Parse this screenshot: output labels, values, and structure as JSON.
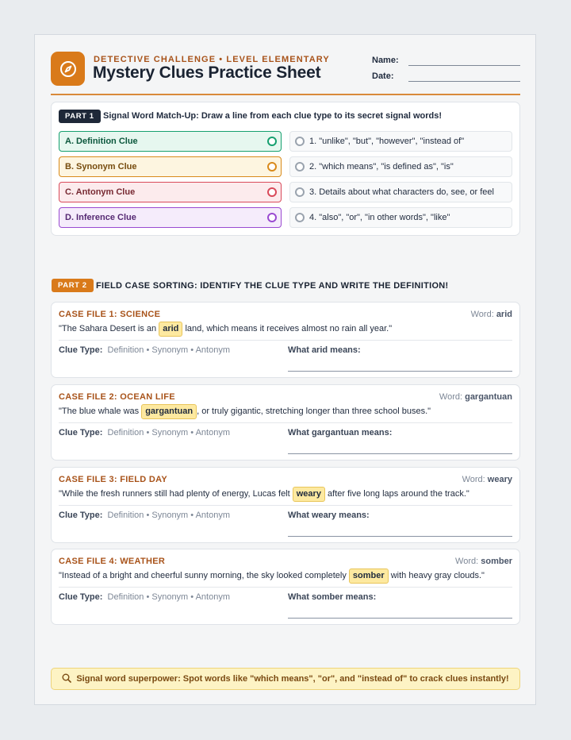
{
  "header": {
    "kicker": "DETECTIVE CHALLENGE • LEVEL ELEMENTARY",
    "title": "Mystery Clues Practice Sheet",
    "name_label": "Name:",
    "date_label": "Date:",
    "logo_icon": "compass-icon"
  },
  "part1": {
    "badge": "PART 1",
    "instruction": "Signal Word Match-Up: Draw a line from each clue type to its secret signal words!",
    "clues": [
      {
        "label": "A. Definition Clue",
        "color": "#16a06f",
        "bg": "#e6f7ef"
      },
      {
        "label": "B. Synonym Clue",
        "color": "#d98a1a",
        "bg": "#fdf5e0"
      },
      {
        "label": "C. Antonym Clue",
        "color": "#d94a5a",
        "bg": "#fcebed"
      },
      {
        "label": "D. Inference Clue",
        "color": "#9a4ad1",
        "bg": "#f5ecfb"
      }
    ],
    "signals": [
      "1. \"unlike\", \"but\", \"however\", \"instead of\"",
      "2. \"which means\", \"is defined as\", \"is\"",
      "3. Details about what characters do, see, or feel",
      "4. \"also\", \"or\", \"in other words\", \"like\""
    ]
  },
  "part2": {
    "badge": "PART 2",
    "title": "FIELD CASE SORTING: IDENTIFY THE CLUE TYPE AND WRITE THE DEFINITION!",
    "word_prefix": "Word:",
    "clue_type_label": "Clue Type:",
    "clue_options": "Definition • Synonym • Antonym",
    "cases": [
      {
        "title": "CASE FILE 1: SCIENCE",
        "word": "arid",
        "before": "\"The Sahara Desert is an",
        "after": "land, which means it receives almost no rain all year.\"",
        "means": "What arid means:"
      },
      {
        "title": "CASE FILE 2: OCEAN LIFE",
        "word": "gargantuan",
        "before": "\"The blue whale was",
        "after": ", or truly gigantic, stretching longer than three school buses.\"",
        "means": "What gargantuan means:"
      },
      {
        "title": "CASE FILE 3: FIELD DAY",
        "word": "weary",
        "before": "\"While the fresh runners still had plenty of energy, Lucas felt",
        "after": "after five long laps around the track.\"",
        "means": "What weary means:"
      },
      {
        "title": "CASE FILE 4: WEATHER",
        "word": "somber",
        "before": "\"Instead of a bright and cheerful sunny morning, the sky looked completely",
        "after": "with heavy gray clouds.\"",
        "means": "What somber means:"
      }
    ]
  },
  "tip": {
    "icon": "magnifier-icon",
    "text": "Signal word superpower: Spot words like \"which means\", \"or\", and \"instead of\" to crack clues instantly!"
  }
}
